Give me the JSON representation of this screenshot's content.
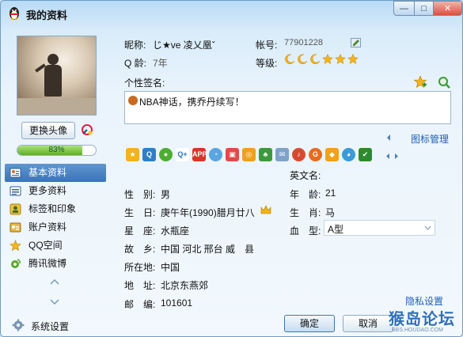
{
  "window": {
    "title": "我的资料",
    "min_label": "—",
    "max_label": "□",
    "close_label": "✕"
  },
  "left": {
    "change_avatar": "更换头像",
    "progress_text": "83%",
    "progress_value": 0.83,
    "nav": [
      {
        "label": "基本资料",
        "active": true,
        "icon": "card-icon"
      },
      {
        "label": "更多资料",
        "active": false,
        "icon": "list-icon"
      },
      {
        "label": "标签和印象",
        "active": false,
        "icon": "tag-icon"
      },
      {
        "label": "账户资料",
        "active": false,
        "icon": "account-icon"
      },
      {
        "label": "QQ空间",
        "active": false,
        "icon": "star-icon"
      },
      {
        "label": "腾讯微博",
        "active": false,
        "icon": "weibo-icon"
      }
    ],
    "system_settings": "系统设置"
  },
  "profile": {
    "nickname_label": "昵称:",
    "nickname": "じ★ve 凌乂凰ˇ",
    "account_label": "帐号:",
    "account": "77901228",
    "age_label": "Q 龄:",
    "age": "7年",
    "level_label": "等级:",
    "signature_label": "个性签名:",
    "signature": "NBA神话，携乔丹续写！",
    "icon_management": "图标管理"
  },
  "fields": {
    "english_name_label": "英文名:",
    "gender_label": "性　别:",
    "gender": "男",
    "age2_label": "年　龄:",
    "age2": "21",
    "birthday_label": "生　日:",
    "birthday": "庚午年(1990)腊月廿八",
    "zodiac_label": "生　肖:",
    "zodiac": "马",
    "constellation_label": "星　座:",
    "constellation": "水瓶座",
    "blood_label": "血　型:",
    "blood": "A型",
    "hometown_label": "故　乡:",
    "hometown": "中国  河北  邢台  威　县",
    "location_label": "所在地:",
    "location": "中国",
    "address_label": "地　址:",
    "address": "北京东燕郊",
    "postcode_label": "邮　编:",
    "postcode": "101601"
  },
  "footer": {
    "privacy": "隐私设置",
    "ok": "确定",
    "cancel": "取消",
    "watermark_big": "猴岛论坛",
    "watermark_small": "BBS.HOUDAO.COM"
  },
  "colors": {
    "accent": "#3a74b6",
    "link": "#1e5fb3",
    "progress": "#5fae27"
  }
}
